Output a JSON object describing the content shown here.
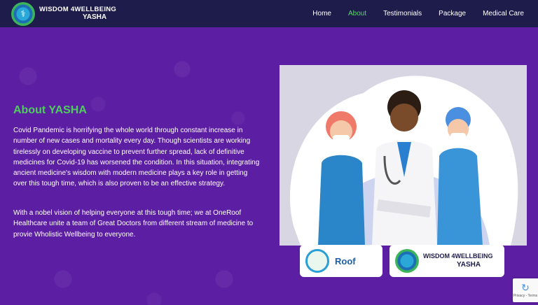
{
  "header": {
    "logo_line1": "WISDOM 4WELLBEING",
    "logo_line2": "YASHA",
    "nav": [
      {
        "label": "Home"
      },
      {
        "label": "About"
      },
      {
        "label": "Testimonials"
      },
      {
        "label": "Package"
      },
      {
        "label": "Medical Care"
      }
    ],
    "active_nav": "About"
  },
  "about": {
    "title": "About YASHA",
    "paragraph1": "Covid Pandemic is horrifying the whole world through constant increase in number of new cases and mortality every day. Though scientists are working tirelessly on developing vaccine to prevent further spread, lack of definitive medicines for Covid-19 has worsened the condition. In this situation, integrating ancient medicine's wisdom with modern medicine plays a key role in getting over this tough time, which is also proven to be an effective strategy.",
    "paragraph2": "With a nobel vision of helping everyone at this tough time; we at OneRoof Healthcare unite a team of Great Doctors from different stream of medicine to provie Wholistic Wellbeing to everyone."
  },
  "partners": {
    "oneroof_label": "Roof",
    "w4_line1": "WISDOM 4WELLBEING",
    "w4_line2": "YASHA"
  },
  "recaptcha": {
    "icon": "recaptcha-icon",
    "text": "Privacy - Terms"
  },
  "colors": {
    "background": "#5c1fa3",
    "header": "#1e1c4a",
    "accent_green": "#4ccf5b",
    "nav_active": "#58d66b"
  }
}
